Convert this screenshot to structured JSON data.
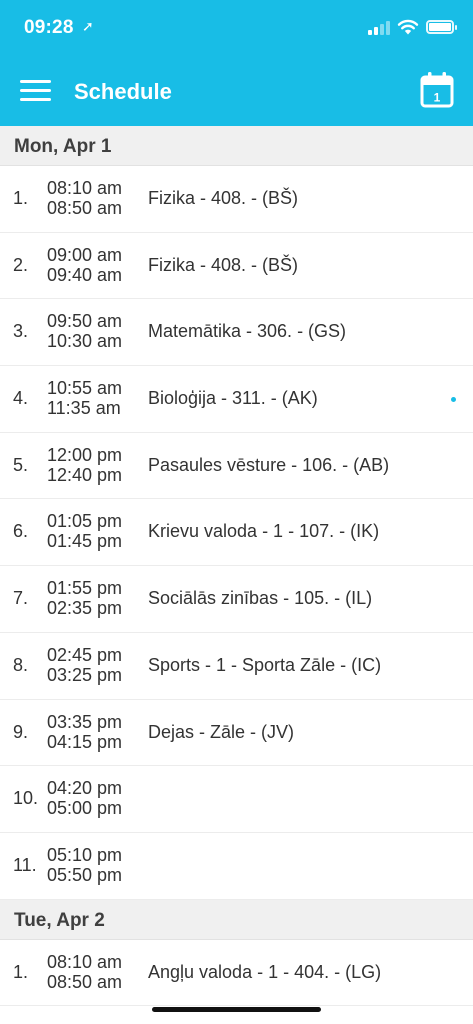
{
  "status_bar": {
    "time": "09:28",
    "location_glyph": "➚"
  },
  "app_bar": {
    "title": "Schedule",
    "calendar_day": "1",
    "background_color": "#18bde6"
  },
  "days": [
    {
      "header": "Mon, Apr 1",
      "lessons": [
        {
          "num": "1.",
          "start": "08:10 am",
          "end": "08:50 am",
          "subject": "Fizika - 408. - (BŠ)",
          "indicator": false
        },
        {
          "num": "2.",
          "start": "09:00 am",
          "end": "09:40 am",
          "subject": "Fizika - 408. - (BŠ)",
          "indicator": false
        },
        {
          "num": "3.",
          "start": "09:50 am",
          "end": "10:30 am",
          "subject": "Matemātika - 306. - (GS)",
          "indicator": false
        },
        {
          "num": "4.",
          "start": "10:55 am",
          "end": "11:35 am",
          "subject": "Bioloģija - 311. - (AK)",
          "indicator": true
        },
        {
          "num": "5.",
          "start": "12:00 pm",
          "end": "12:40 pm",
          "subject": "Pasaules vēsture - 106. - (AB)",
          "indicator": false
        },
        {
          "num": "6.",
          "start": "01:05 pm",
          "end": "01:45 pm",
          "subject": "Krievu valoda - 1 - 107. - (IK)",
          "indicator": false
        },
        {
          "num": "7.",
          "start": "01:55 pm",
          "end": "02:35 pm",
          "subject": "Sociālās zinības - 105. - (IL)",
          "indicator": false
        },
        {
          "num": "8.",
          "start": "02:45 pm",
          "end": "03:25 pm",
          "subject": "Sports - 1 - Sporta Zāle - (IC)",
          "indicator": false
        },
        {
          "num": "9.",
          "start": "03:35 pm",
          "end": "04:15 pm",
          "subject": "Dejas - Zāle - (JV)",
          "indicator": false
        },
        {
          "num": "10.",
          "start": "04:20 pm",
          "end": "05:00 pm",
          "subject": "",
          "indicator": false
        },
        {
          "num": "11.",
          "start": "05:10 pm",
          "end": "05:50 pm",
          "subject": "",
          "indicator": false
        }
      ]
    },
    {
      "header": "Tue, Apr 2",
      "lessons": [
        {
          "num": "1.",
          "start": "08:10 am",
          "end": "08:50 am",
          "subject": "Angļu valoda - 1 - 404. - (LG)",
          "indicator": false
        }
      ]
    }
  ]
}
